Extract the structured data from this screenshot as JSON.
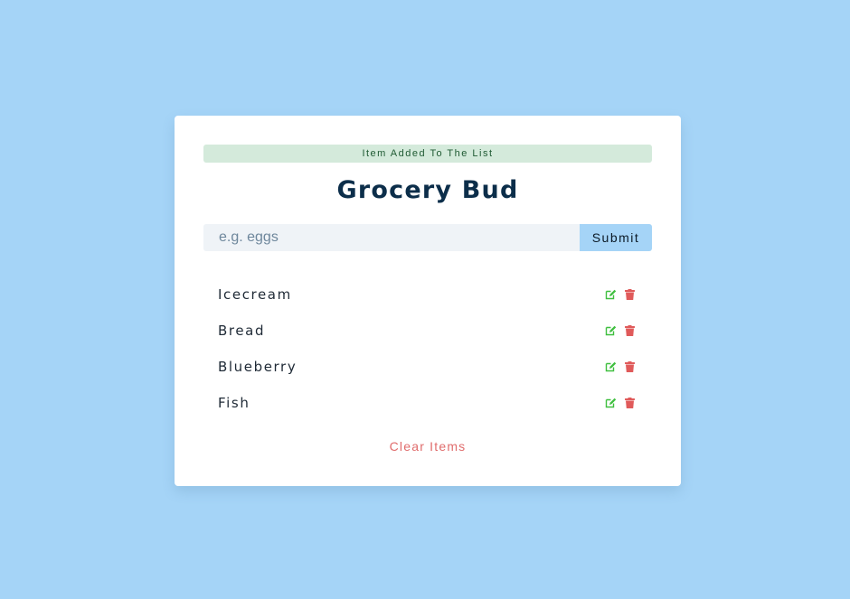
{
  "alert": {
    "text": "Item Added To The List",
    "type": "success"
  },
  "title": "Grocery Bud",
  "form": {
    "input_placeholder": "e.g. eggs",
    "input_value": "",
    "submit_label": "Submit"
  },
  "items": [
    {
      "title": "Icecream"
    },
    {
      "title": "Bread"
    },
    {
      "title": "Blueberry"
    },
    {
      "title": "Fish"
    }
  ],
  "item_actions": {
    "edit_icon": "edit-icon",
    "delete_icon": "trash-icon"
  },
  "clear_label": "Clear Items",
  "colors": {
    "background": "#a5d4f7",
    "card": "#ffffff",
    "alert_bg": "#d4eadb",
    "alert_text": "#1f5a33",
    "title": "#0c2e4a",
    "edit": "#3fbf3f",
    "delete": "#e05a5a",
    "clear": "#e06c6c"
  }
}
